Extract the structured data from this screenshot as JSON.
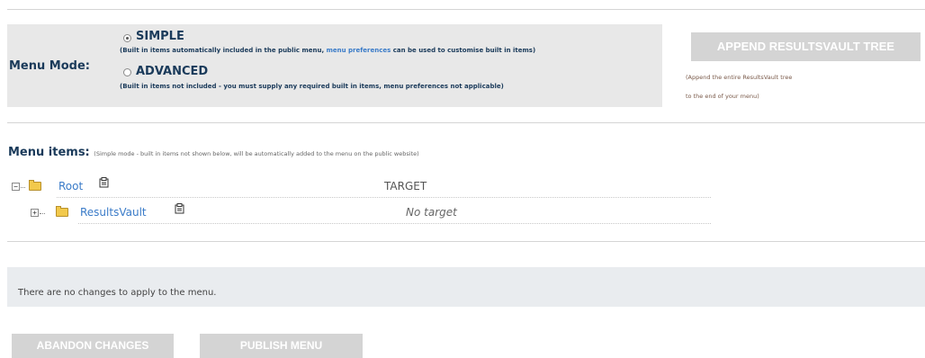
{
  "menu_mode": {
    "label": "Menu Mode:",
    "simple": {
      "label": "SIMPLE",
      "selected": true,
      "desc_before": "(Built in items automatically included in the public menu, ",
      "desc_link": "menu preferences",
      "desc_after": " can be used to customise built in items)"
    },
    "advanced": {
      "label": "ADVANCED",
      "selected": false,
      "desc": "(Built in items not included - you must supply any required built in items, menu preferences not applicable)"
    }
  },
  "append_button": {
    "label": "APPEND RESULTSVAULT TREE",
    "note_line1": "(Append the entire ResultsVault tree",
    "note_line2": "to the end of your menu)"
  },
  "menu_items": {
    "title": "Menu items:",
    "subtitle": "(Simple mode - built in items not shown below, will be automatically added to the menu on the public website)",
    "tree": [
      {
        "label": "Root",
        "target": "TARGET",
        "expanded": true,
        "icon": "folder-open-icon"
      },
      {
        "label": "ResultsVault",
        "target": "No target",
        "expanded": false,
        "icon": "folder-icon"
      }
    ]
  },
  "status": {
    "message": "There are no changes to apply to the menu."
  },
  "actions": {
    "abandon_label": "ABANDON CHANGES",
    "publish_label": "PUBLISH MENU"
  },
  "colors": {
    "accent_link": "#3a7bc8",
    "label_navy": "#1a3a5a",
    "button_disabled": "#d4d4d4",
    "panel_gray": "#e8e8e8",
    "status_panel": "#e9ecef"
  }
}
